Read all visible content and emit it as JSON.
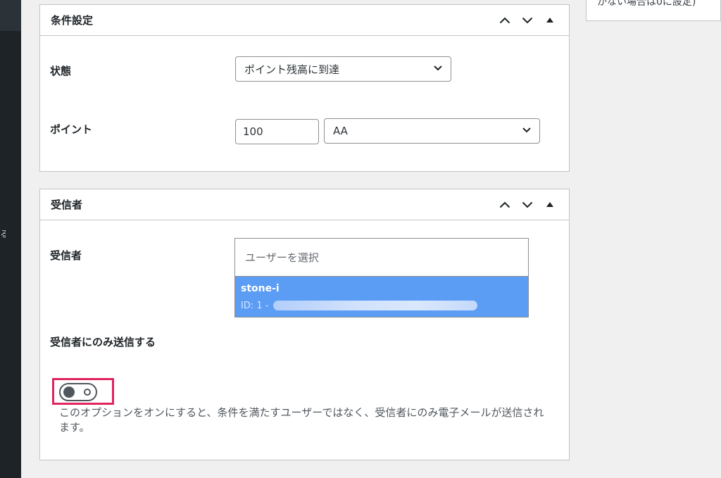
{
  "conditions_panel": {
    "title": "条件設定",
    "state_label": "状態",
    "state_value": "ポイント残高に到達",
    "points_label": "ポイント",
    "points_value": "100",
    "points_type_value": "AA"
  },
  "recipients_panel": {
    "title": "受信者",
    "recipients_label": "受信者",
    "user_search_placeholder": "ユーザーを選択",
    "dropdown_option": {
      "username": "stone-i",
      "id_text": "ID: 1 -"
    },
    "only_recipients_label": "受信者にのみ送信する",
    "toggle_state": "off",
    "description": "このオプションをオンにすると、条件を満たすユーザーではなく、受信者にのみ電子メールが送信されます。"
  },
  "side_panel": {
    "text": "かない場合は0に設定)"
  },
  "colors": {
    "accent_highlight": "#e0245e",
    "dropdown_selected": "#5b9cf5",
    "admin_sidebar": "#1d2327"
  }
}
